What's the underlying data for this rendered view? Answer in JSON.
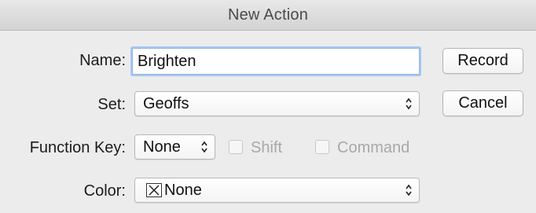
{
  "window": {
    "title": "New Action"
  },
  "form": {
    "name_label": "Name:",
    "name_value": "Brighten",
    "set_label": "Set:",
    "set_value": "Geoffs",
    "function_key_label": "Function Key:",
    "function_key_value": "None",
    "shift_label": "Shift",
    "shift_checked": false,
    "command_label": "Command",
    "command_checked": false,
    "color_label": "Color:",
    "color_value": "None",
    "color_swatch_icon": "none-swatch-icon"
  },
  "buttons": {
    "record_label": "Record",
    "cancel_label": "Cancel"
  }
}
